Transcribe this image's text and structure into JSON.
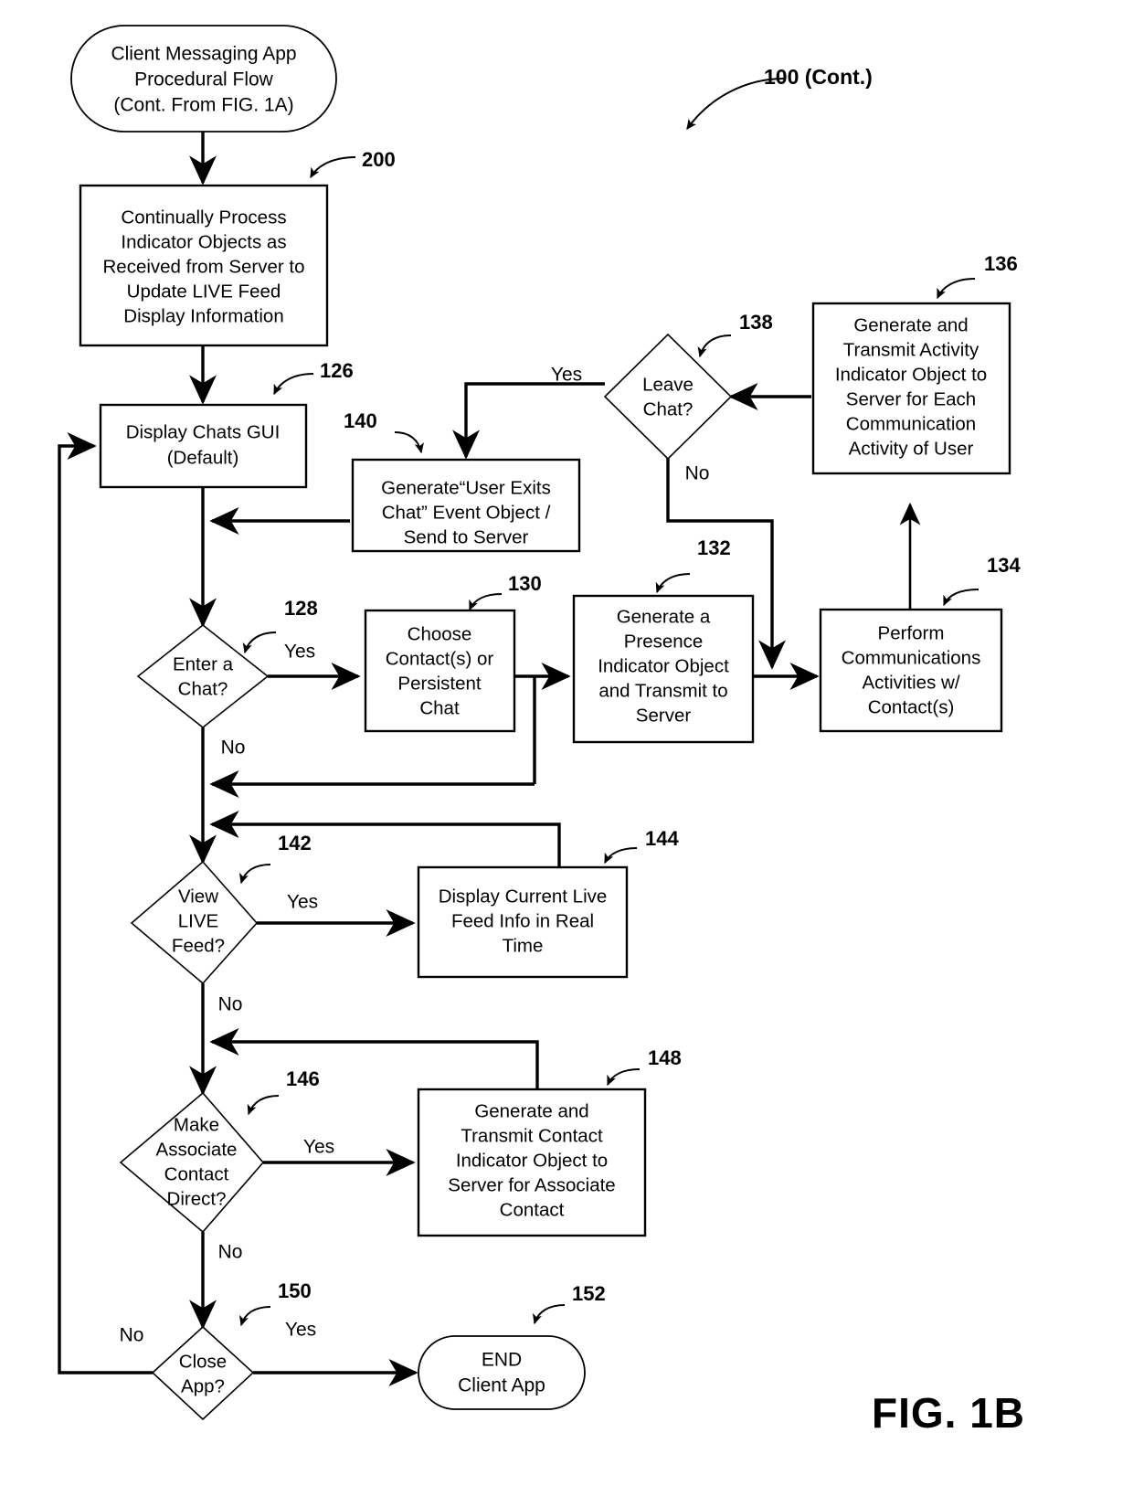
{
  "figure": {
    "label": "FIG. 1B",
    "flow_ref": "100 (Cont.)"
  },
  "nodes": {
    "start": {
      "ref": "",
      "type": "terminator",
      "lines": [
        "Client Messaging App",
        "Procedural Flow",
        "(Cont. From FIG. 1A)"
      ]
    },
    "n200": {
      "ref": "200",
      "type": "process",
      "lines": [
        "Continually Process",
        "Indicator Objects as",
        "Received from Server to",
        "Update LIVE Feed",
        "Display Information"
      ]
    },
    "n126": {
      "ref": "126",
      "type": "process",
      "lines": [
        "Display Chats GUI",
        "(Default)"
      ]
    },
    "n140": {
      "ref": "140",
      "type": "process",
      "lines": [
        "Generate“User Exits",
        "Chat” Event Object /",
        "Send to Server"
      ]
    },
    "n138": {
      "ref": "138",
      "type": "decision",
      "lines": [
        "Leave",
        "Chat?"
      ]
    },
    "n136": {
      "ref": "136",
      "type": "process",
      "lines": [
        "Generate and",
        "Transmit Activity",
        "Indicator Object to",
        "Server for Each",
        "Communication",
        "Activity of User"
      ]
    },
    "n128": {
      "ref": "128",
      "type": "decision",
      "lines": [
        "Enter a",
        "Chat?"
      ]
    },
    "n130": {
      "ref": "130",
      "type": "process",
      "lines": [
        "Choose",
        "Contact(s) or",
        "Persistent",
        "Chat"
      ]
    },
    "n132": {
      "ref": "132",
      "type": "process",
      "lines": [
        "Generate a",
        "Presence",
        "Indicator Object",
        "and Transmit to",
        "Server"
      ]
    },
    "n134": {
      "ref": "134",
      "type": "process",
      "lines": [
        "Perform",
        "Communications",
        "Activities w/",
        "Contact(s)"
      ]
    },
    "n142": {
      "ref": "142",
      "type": "decision",
      "lines": [
        "View",
        "LIVE",
        "Feed?"
      ]
    },
    "n144": {
      "ref": "144",
      "type": "process",
      "lines": [
        "Display Current Live",
        "Feed Info in Real",
        "Time"
      ]
    },
    "n146": {
      "ref": "146",
      "type": "decision",
      "lines": [
        "Make",
        "Associate",
        "Contact",
        "Direct?"
      ]
    },
    "n148": {
      "ref": "148",
      "type": "process",
      "lines": [
        "Generate and",
        "Transmit Contact",
        "Indicator Object to",
        "Server for Associate",
        "Contact"
      ]
    },
    "n150": {
      "ref": "150",
      "type": "decision",
      "lines": [
        "Close",
        "App?"
      ]
    },
    "n152": {
      "ref": "152",
      "type": "terminator",
      "lines": [
        "END",
        "Client App"
      ]
    }
  },
  "edge_labels": {
    "leave_chat_yes": "Yes",
    "leave_chat_no": "No",
    "enter_chat_yes": "Yes",
    "enter_chat_no": "No",
    "view_live_yes": "Yes",
    "view_live_no": "No",
    "associate_yes": "Yes",
    "associate_no": "No",
    "close_app_yes": "Yes",
    "close_app_no": "No"
  },
  "colors": {
    "stroke": "#000000",
    "fill": "#ffffff"
  }
}
